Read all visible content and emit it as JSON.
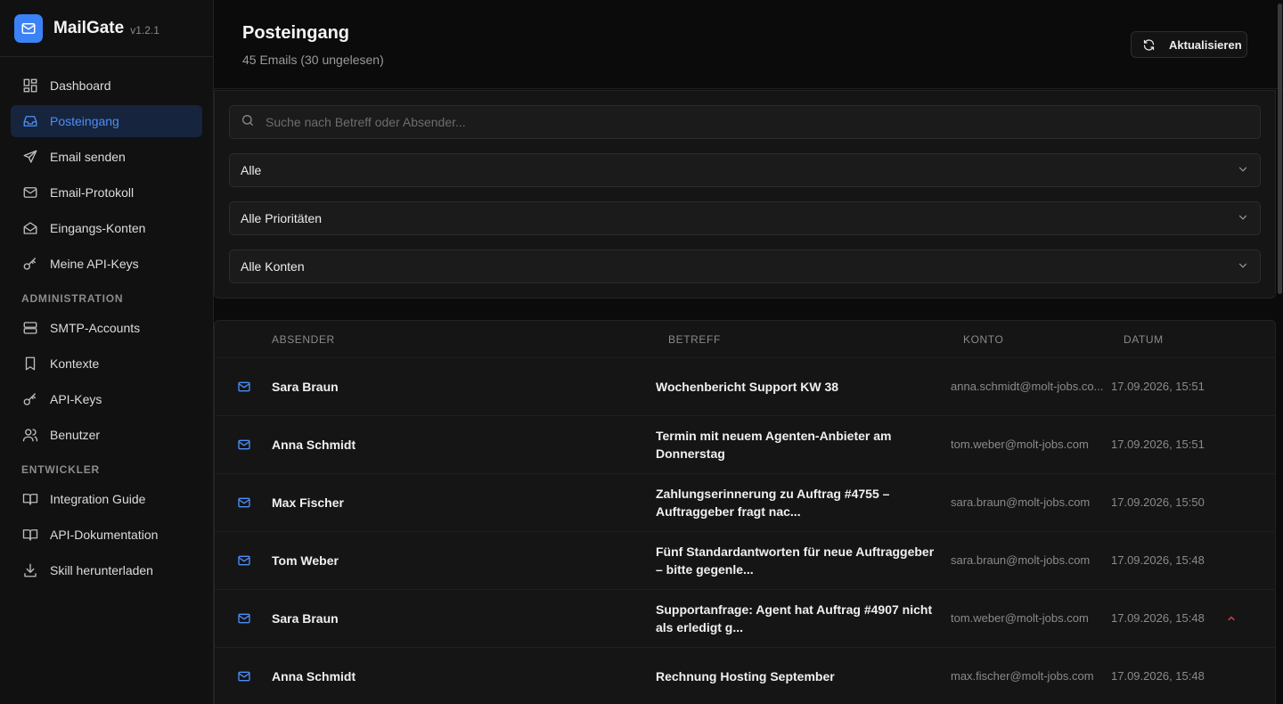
{
  "app": {
    "name": "MailGate",
    "version": "v1.2.1"
  },
  "sidebar": {
    "items": [
      {
        "label": "Dashboard"
      },
      {
        "label": "Posteingang"
      },
      {
        "label": "Email senden"
      },
      {
        "label": "Email-Protokoll"
      },
      {
        "label": "Eingangs-Konten"
      },
      {
        "label": "Meine API-Keys"
      }
    ],
    "admin_title": "ADMINISTRATION",
    "admin_items": [
      {
        "label": "SMTP-Accounts"
      },
      {
        "label": "Kontexte"
      },
      {
        "label": "API-Keys"
      },
      {
        "label": "Benutzer"
      }
    ],
    "dev_title": "ENTWICKLER",
    "dev_items": [
      {
        "label": "Integration Guide"
      },
      {
        "label": "API-Dokumentation"
      },
      {
        "label": "Skill herunterladen"
      }
    ]
  },
  "header": {
    "title": "Posteingang",
    "subtitle": "45 Emails (30 ungelesen)",
    "refresh_label": "Aktualisieren"
  },
  "filters": {
    "search_placeholder": "Suche nach Betreff oder Absender...",
    "status_value": "Alle",
    "priority_value": "Alle Prioritäten",
    "account_value": "Alle Konten"
  },
  "table": {
    "columns": {
      "from": "ABSENDER",
      "subject": "BETREFF",
      "account": "KONTO",
      "date": "DATUM"
    },
    "rows": [
      {
        "from": "Sara Braun",
        "subject": "Wochenbericht Support KW 38",
        "account": "anna.schmidt@molt-jobs.co...",
        "date": "17.09.2026, 15:51"
      },
      {
        "from": "Anna Schmidt",
        "subject": "Termin mit neuem Agenten-Anbieter am Donnerstag",
        "account": "tom.weber@molt-jobs.com",
        "date": "17.09.2026, 15:51"
      },
      {
        "from": "Max Fischer",
        "subject": "Zahlungserinnerung zu Auftrag #4755 – Auftraggeber fragt nac...",
        "account": "sara.braun@molt-jobs.com",
        "date": "17.09.2026, 15:50"
      },
      {
        "from": "Tom Weber",
        "subject": "Fünf Standardantworten für neue Auftraggeber – bitte gegenle...",
        "account": "sara.braun@molt-jobs.com",
        "date": "17.09.2026, 15:48"
      },
      {
        "from": "Sara Braun",
        "subject": "Supportanfrage: Agent hat Auftrag #4907 nicht als erledigt g...",
        "account": "tom.weber@molt-jobs.com",
        "date": "17.09.2026, 15:48"
      },
      {
        "from": "Anna Schmidt",
        "subject": "Rechnung Hosting September",
        "account": "max.fischer@molt-jobs.com",
        "date": "17.09.2026, 15:48"
      }
    ]
  },
  "colors": {
    "accent": "#3b82f6",
    "priority_high": "#ef4444"
  }
}
